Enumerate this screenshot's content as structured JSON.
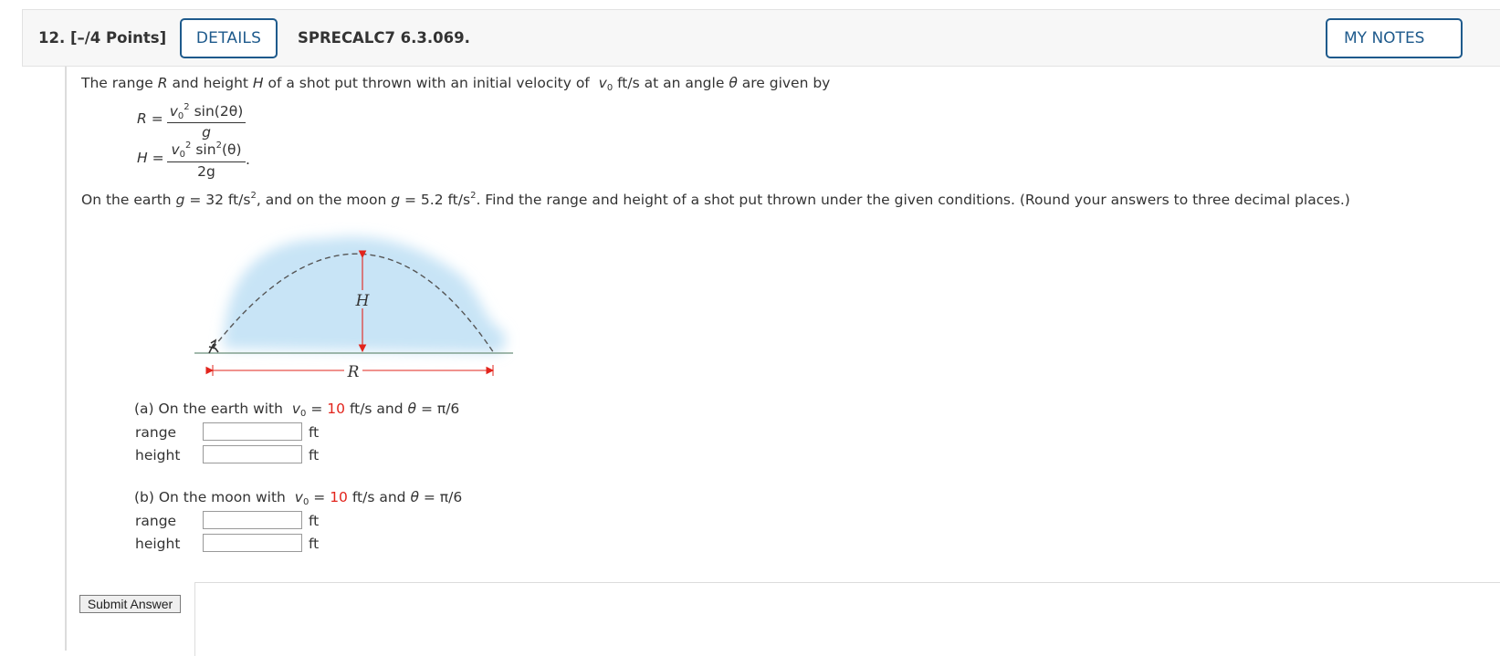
{
  "header": {
    "question_number": "12.",
    "points": "[–/4 Points]",
    "details_label": "DETAILS",
    "code": "SPRECALC7 6.3.069.",
    "my_notes_label": "MY NOTES"
  },
  "intro": {
    "p1": "The range",
    "R": "R",
    "p2": "and height",
    "H": "H",
    "p3": "of a shot put thrown with an initial velocity of",
    "v0": "v",
    "v0_sub": "0",
    "p4": "ft/s  at an angle",
    "theta": "θ",
    "p5": "are given by"
  },
  "formulas": {
    "R_lhs": "R =",
    "R_num": "v",
    "R_num_sub": "0",
    "R_num_sup": "2",
    "R_num_rest": " sin(2θ)",
    "R_den": "g",
    "H_lhs": "H =",
    "H_num": "v",
    "H_num_sub": "0",
    "H_num_sup": "2",
    "H_num_rest1": " sin",
    "H_num_sup2": "2",
    "H_num_rest2": "(θ)",
    "H_den": "2g",
    "H_end": "."
  },
  "conditions": {
    "c1": "On the earth",
    "g1": "g",
    "c2": "= 32 ft/s",
    "c2_sup": "2",
    "c3": ", and on the moon",
    "g2": "g",
    "c4": "= 5.2 ft/s",
    "c4_sup": "2",
    "c5": ". Find the range and height of a shot put thrown under the given conditions. (Round your answers to three decimal places.)"
  },
  "figure": {
    "H_label": "H",
    "R_label": "R",
    "colors": {
      "cloud": "#c8e4f6",
      "arrow": "#e2241c",
      "ground": "#6b8f7a",
      "path": "#555555"
    }
  },
  "part_a": {
    "label": "(a) On the earth with",
    "v": "v",
    "v_sub": "0",
    "eq": "=",
    "value": "10",
    "unit": "ft/s  and",
    "theta": "θ",
    "theta_val": "= π/6",
    "range_label": "range",
    "height_label": "height",
    "unit_ft_1": "ft",
    "unit_ft_2": "ft"
  },
  "part_b": {
    "label": "(b) On the moon with",
    "v": "v",
    "v_sub": "0",
    "eq": "=",
    "value": "10",
    "unit": "ft/s  and",
    "theta": "θ",
    "theta_val": "= π/6",
    "range_label": "range",
    "height_label": "height",
    "unit_ft_1": "ft",
    "unit_ft_2": "ft"
  },
  "submit_label": "Submit Answer"
}
